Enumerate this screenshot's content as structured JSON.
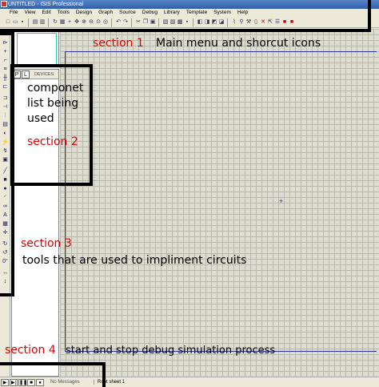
{
  "window": {
    "title": "UNTITLED - ISIS Professional"
  },
  "menu": [
    "File",
    "View",
    "Edit",
    "Tools",
    "Design",
    "Graph",
    "Source",
    "Debug",
    "Library",
    "Template",
    "System",
    "Help"
  ],
  "devices_panel": {
    "tab_p": "P",
    "tab_l": "L",
    "title": "DEVICES"
  },
  "status": {
    "message": "No Messages",
    "sheet": "Root sheet 1"
  },
  "annotations": {
    "section1_label": "section 1",
    "section1_desc": "Main menu and shorcut icons",
    "section2_desc_line1": "componet",
    "section2_desc_line2": "list being",
    "section2_desc_line3": "used",
    "section2_label": "section 2",
    "section3_label": "section 3",
    "section3_desc": "tools that are used to impliment circuits",
    "section4_label": "section 4",
    "section4_desc": "start and stop debug simulation process"
  },
  "colors": {
    "annotation_red": "#e00000",
    "sheet_border": "#3333aa",
    "grid_bg": "#dcdcd0"
  }
}
